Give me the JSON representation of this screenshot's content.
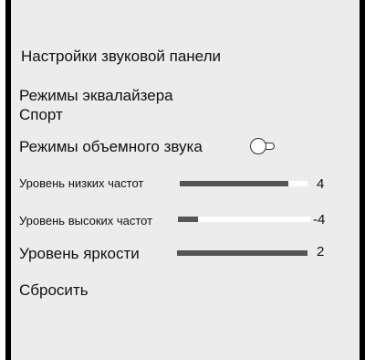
{
  "panel": {
    "title": "Настройки звуковой панели",
    "background_color": "#ececec",
    "frame_color": "#000000"
  },
  "equalizer": {
    "label": "Режимы эквалайзера",
    "value": "Спорт"
  },
  "surround": {
    "label": "Режимы объемного звука",
    "toggle_on": false,
    "icon": "toggle-off-icon"
  },
  "bass": {
    "label": "Уровень низких частот",
    "value_text": "4",
    "fill_fraction": 0.85
  },
  "treble": {
    "label": "Уровень высоких частот",
    "value_text": "-4",
    "fill_fraction": 0.15
  },
  "brightness": {
    "label": "Уровень яркости",
    "value_text": "2",
    "fill_fraction": 1.0
  },
  "reset": {
    "label": "Сбросить"
  },
  "colors": {
    "slider_fill": "#555555",
    "slider_track": "#ffffff"
  }
}
